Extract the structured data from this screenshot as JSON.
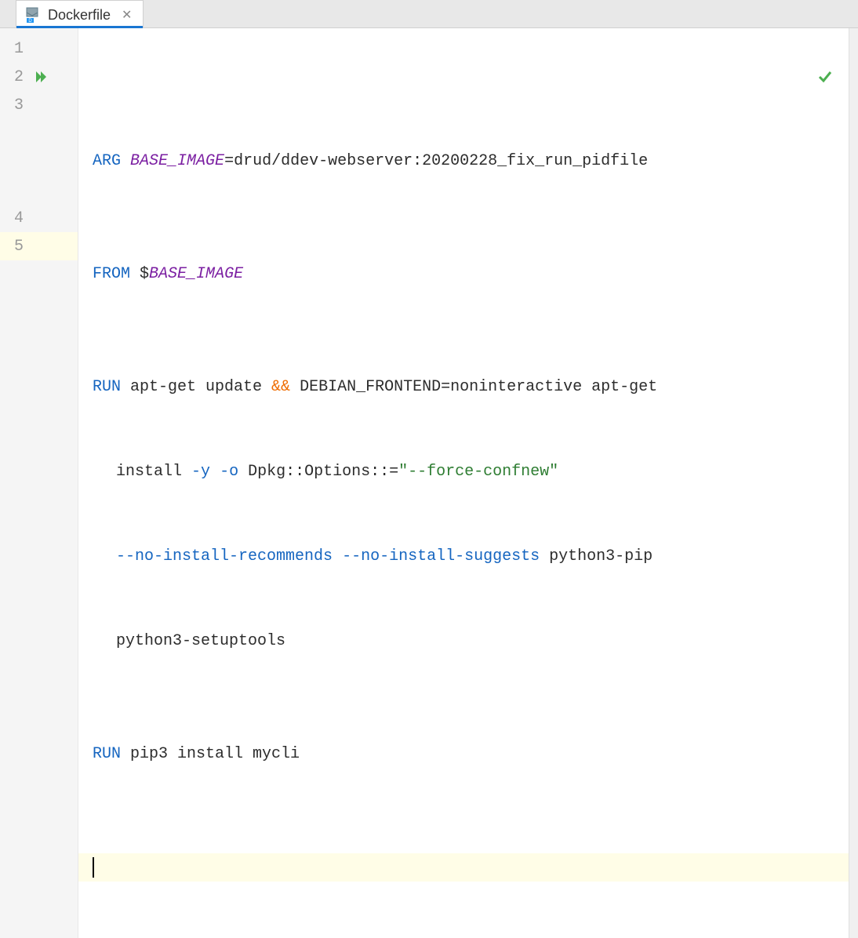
{
  "tab": {
    "filename": "Dockerfile"
  },
  "gutter": {
    "lines": [
      "1",
      "2",
      "3",
      "4",
      "5"
    ]
  },
  "code": {
    "line1": {
      "kw": "ARG",
      "var": "BASE_IMAGE",
      "eq": "=",
      "value": "drud/ddev-webserver:20200228_fix_run_pidfile"
    },
    "line2": {
      "kw": "FROM",
      "dollar": "$",
      "var": "BASE_IMAGE"
    },
    "line3": {
      "kw": "RUN",
      "seg1": " apt-get update ",
      "op": "&&",
      "seg2": " DEBIAN_FRONTEND=noninteractive apt-get",
      "cont1a": " install ",
      "flag1": "-y",
      "cont1b": " ",
      "flag2": "-o",
      "cont1c": " Dpkg::Options::=",
      "str": "\"--force-confnew\"",
      "cont2a": " ",
      "flag3": "--no-install-recommends",
      "cont2b": " ",
      "flag4": "--no-install-suggests",
      "cont2c": " python3-pip",
      "cont3": " python3-setuptools"
    },
    "line4": {
      "kw": "RUN",
      "seg": " pip3 install mycli"
    }
  }
}
